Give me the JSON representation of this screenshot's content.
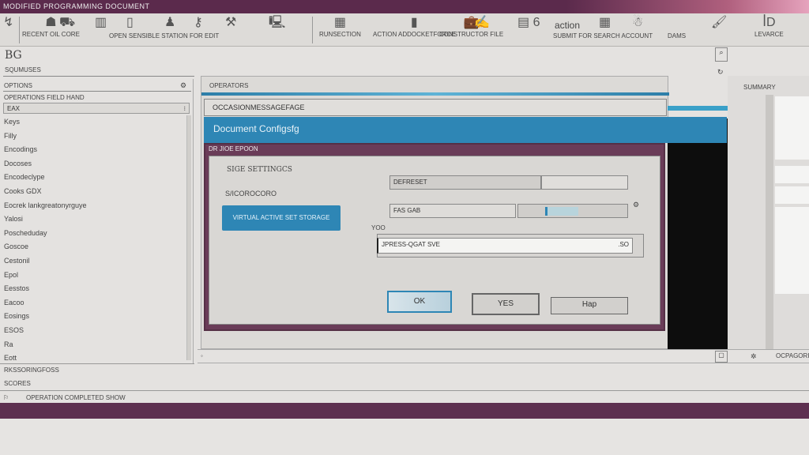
{
  "window": {
    "title": "MODIFIED PROGRAMMING DOCUMENT"
  },
  "toolbar": {
    "items": [
      {
        "icon": "users-icon",
        "label": "RECENT OIL CORE"
      },
      {
        "icon": "truck-icon",
        "label": ""
      },
      {
        "icon": "chart-icon",
        "label": "OPEN SENSIBLE STATION FOR EDIT"
      },
      {
        "icon": "document-icon",
        "label": ""
      },
      {
        "icon": "person-icon",
        "label": ""
      },
      {
        "icon": "key-icon",
        "label": ""
      },
      {
        "icon": "tools-icon",
        "label": ""
      },
      {
        "icon": "computer-icon",
        "label": ""
      },
      {
        "icon": "grid-icon",
        "label": "RUNSECTION"
      },
      {
        "icon": "bookmark-icon",
        "label": "ACTION ADDOCKETFORCE"
      },
      {
        "icon": "briefcase-icon",
        "label": "CONSTRUCTOR FILE"
      },
      {
        "icon": "signature-icon",
        "label": ""
      },
      {
        "icon": "table-icon",
        "label": "6"
      },
      {
        "icon": "",
        "label": "action"
      },
      {
        "icon": "building-icon",
        "label": "SUBMIT FOR SEARCH ACCOUNT"
      },
      {
        "icon": "people-icon",
        "label": ""
      },
      {
        "icon": "",
        "label": "DAMS"
      },
      {
        "icon": "paint-icon",
        "label": ""
      },
      {
        "icon": "id-icon",
        "label": "LEVARCE"
      }
    ]
  },
  "panel": {
    "badge": "BG",
    "subtitle": "SQUMUSES"
  },
  "sidebar": {
    "header": "OPTIONS",
    "field_label": "OPERATIONS FIELD HAND",
    "dropdown_value": "EAX",
    "items": [
      "Keys",
      "Filly",
      "Encodings",
      "Docoses",
      "Encodeclype",
      "Cooks GDX",
      "Eocrek lankgreatonyrguye",
      "Yalosi",
      "Poscheduday",
      "Goscoe",
      "Cestonil",
      "Epol",
      "Eesstos",
      "Eacoo",
      "Eosings",
      "ESOS",
      "Ra",
      "Eott"
    ],
    "footer_lines": [
      "RKSSORINGFOSS",
      "SCORES"
    ]
  },
  "status": {
    "text": "OPERATION COMPLETED SHOW"
  },
  "main": {
    "header": "OPERATORS",
    "message": "OCCASIONMESSAGEFAGE",
    "blue_title": "Document Configsfg",
    "dialog": {
      "title": "DR JIOE EPOON",
      "section": "SIGE SETTINGCS",
      "sub_label": "S/ICOROCORO",
      "action_button": "VIRTUAL ACTIVE SET STORAGE",
      "field1": "DEFRESET",
      "field2": "FAS GAB",
      "field3_label": "YOO",
      "field3_value": "JPRESS-QGAT SVE",
      "field3_suffix": ".SO",
      "ok": "OK",
      "apply": "YES",
      "cancel": "Hap"
    }
  },
  "right": {
    "title": "SUMMARY"
  },
  "bottom_bar": {
    "cell3": "OCPAGORI"
  }
}
